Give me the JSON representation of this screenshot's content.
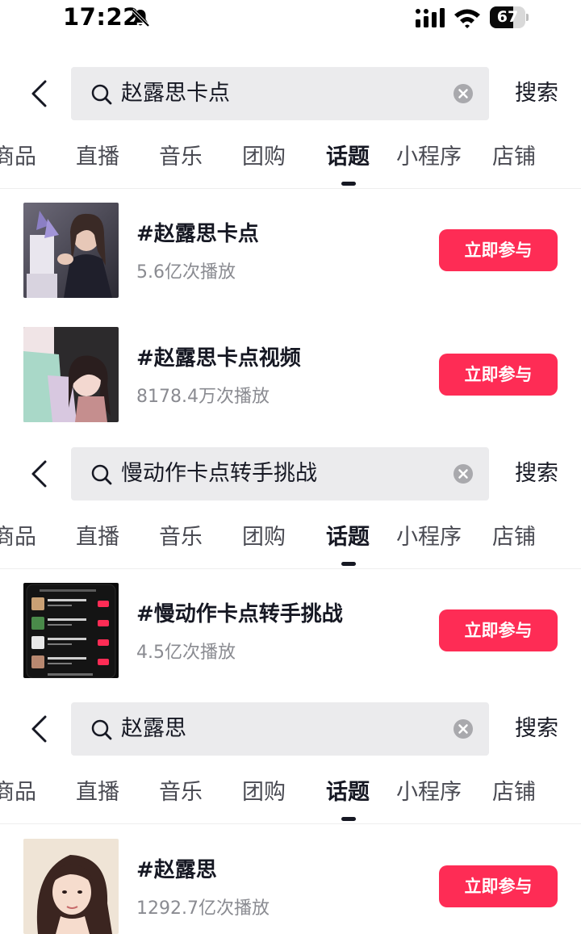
{
  "status_bar": {
    "time": "17:22",
    "battery": "67",
    "battery_level": 0.67,
    "icons": [
      "bell-muted-icon",
      "signal-icon",
      "wifi-icon",
      "battery-icon"
    ]
  },
  "search_bar": {
    "back_icon": "chevron-left-icon",
    "search_icon": "search-icon",
    "clear_icon": "clear-icon",
    "button_label": "搜索"
  },
  "tabs": [
    "商品",
    "直播",
    "音乐",
    "团购",
    "话题",
    "小程序",
    "店铺"
  ],
  "active_tab": "话题",
  "colors": {
    "accent": "#fe2c55",
    "text_primary": "#161823",
    "text_secondary": "#8a8b91",
    "search_bg": "#ebebed"
  },
  "sections": [
    {
      "query": "赵露思卡点",
      "results": [
        {
          "title": "#赵露思卡点",
          "plays": "5.6亿次播放",
          "button": "立即参与"
        },
        {
          "title": "#赵露思卡点视频",
          "plays": "8178.4万次播放",
          "button": "立即参与"
        }
      ]
    },
    {
      "query": "慢动作卡点转手挑战",
      "results": [
        {
          "title": "#慢动作卡点转手挑战",
          "plays": "4.5亿次播放",
          "button": "立即参与"
        }
      ]
    },
    {
      "query": "赵露思",
      "results": [
        {
          "title": "#赵露思",
          "plays": "1292.7亿次播放",
          "button": "立即参与"
        }
      ]
    }
  ]
}
